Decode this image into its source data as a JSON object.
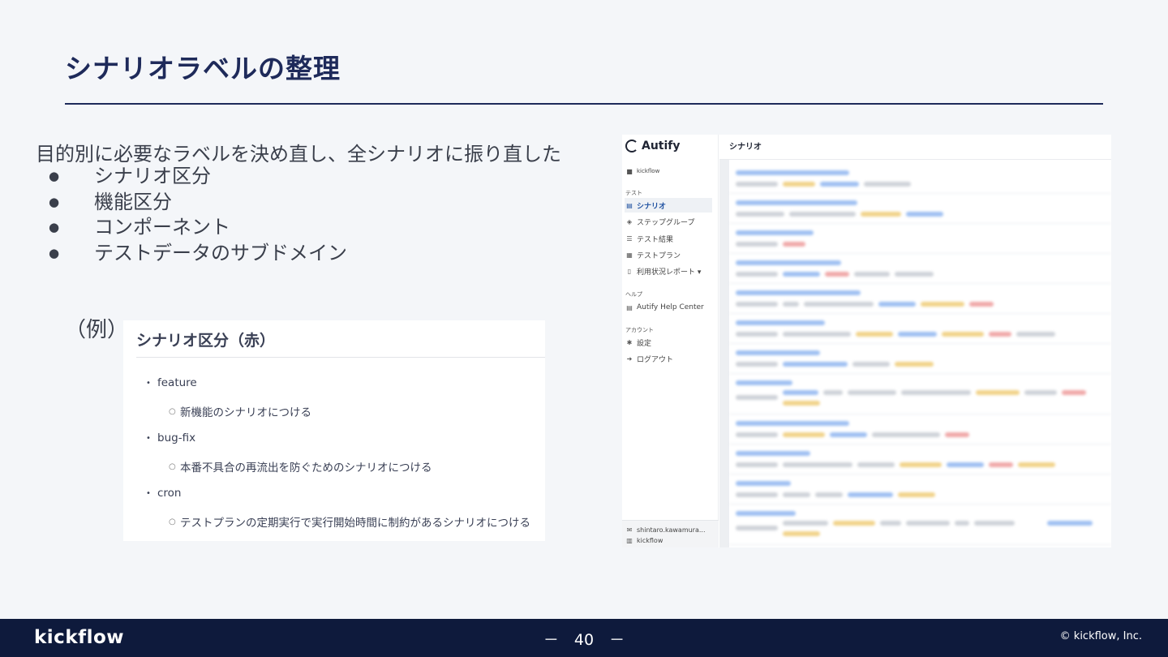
{
  "slide": {
    "title": "シナリオラベルの整理",
    "intro": "目的別に必要なラベルを決め直し、全シナリオに振り直した",
    "bullet_glyph": "●",
    "bullets": [
      "シナリオ区分",
      "機能区分",
      "コンポーネント",
      "テストデータのサブドメイン"
    ],
    "example_label": "（例）"
  },
  "example_card": {
    "title": "シナリオ区分（赤）",
    "bullet": "•",
    "sub_bullet": "○",
    "items": [
      {
        "label": "feature",
        "note": "新機能のシナリオにつける"
      },
      {
        "label": "bug-fix",
        "note": "本番不具合の再流出を防ぐためのシナリオにつける"
      },
      {
        "label": "cron",
        "note": "テストプランの定期実行で実行開始時間に制約があるシナリオにつける"
      }
    ]
  },
  "app": {
    "logo_text": "Autify",
    "workspace": "kickflow",
    "section_test": "テスト",
    "nav": [
      {
        "label": "シナリオ",
        "icon": "book-icon",
        "glyph": "▤",
        "active": true
      },
      {
        "label": "ステップグループ",
        "icon": "layers-icon",
        "glyph": "◈",
        "active": false
      },
      {
        "label": "テスト結果",
        "icon": "list-check-icon",
        "glyph": "☰",
        "active": false
      },
      {
        "label": "テストプラン",
        "icon": "calendar-icon",
        "glyph": "▦",
        "active": false
      },
      {
        "label": "利用状況レポート ▾",
        "icon": "report-icon",
        "glyph": "▯",
        "active": false
      }
    ],
    "section_help": "ヘルプ",
    "help_center": "Autify Help Center",
    "section_account": "アカウント",
    "settings": "設定",
    "logout": "ログアウト",
    "user": "shintaro.kawamura...",
    "org": "kickflow",
    "main_title": "シナリオ"
  },
  "footer": {
    "brand": "kickflow",
    "page_number": "－　40　－",
    "copyright": "© kickflow, Inc."
  },
  "colors": {
    "title": "#1e2a5a",
    "footer_bg": "#0e1a3c",
    "accent_blue": "#1c4fa0"
  }
}
